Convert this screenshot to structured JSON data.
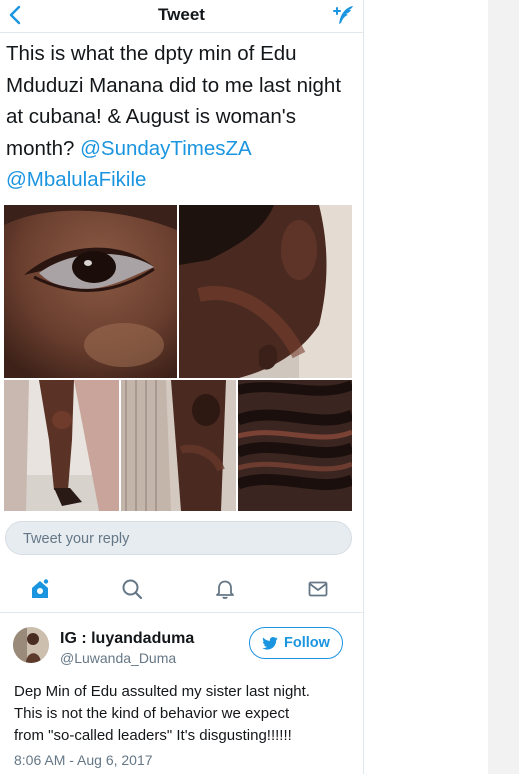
{
  "header": {
    "title": "Tweet",
    "back_icon": "chevron-left-icon",
    "compose_icon": "compose-tweet-icon"
  },
  "tweet": {
    "text_lines": [
      "This is what the dpty min of Edu",
      "Mduduzi Manana did to me last night",
      "at cubana! & August is woman's",
      "month?"
    ],
    "mention_1": "@SundayTimesZA",
    "mention_2": "@MbalulaFikile"
  },
  "media": {
    "photos": [
      "eye-closeup-photo",
      "neck-photo",
      "legs-photo",
      "knee-photo",
      "braided-hair-photo"
    ]
  },
  "reply": {
    "placeholder": "Tweet your reply"
  },
  "nav": {
    "items": [
      "home-icon",
      "search-icon",
      "notifications-icon",
      "messages-icon"
    ],
    "active": "home-icon"
  },
  "embedded_tweet": {
    "name": "IG : luyandaduma",
    "handle": "@Luwanda_Duma",
    "follow_label": "Follow",
    "text_lines": [
      "Dep Min of Edu assulted my sister last night.",
      "This is not the kind of behavior we expect",
      "from \"so-called leaders\" It's disgusting!!!!!!"
    ],
    "timestamp": "8:06 AM - Aug 6, 2017"
  },
  "colors": {
    "accent": "#1b95e0",
    "secondary_text": "#657786",
    "reply_bg": "#e6ecf0"
  }
}
